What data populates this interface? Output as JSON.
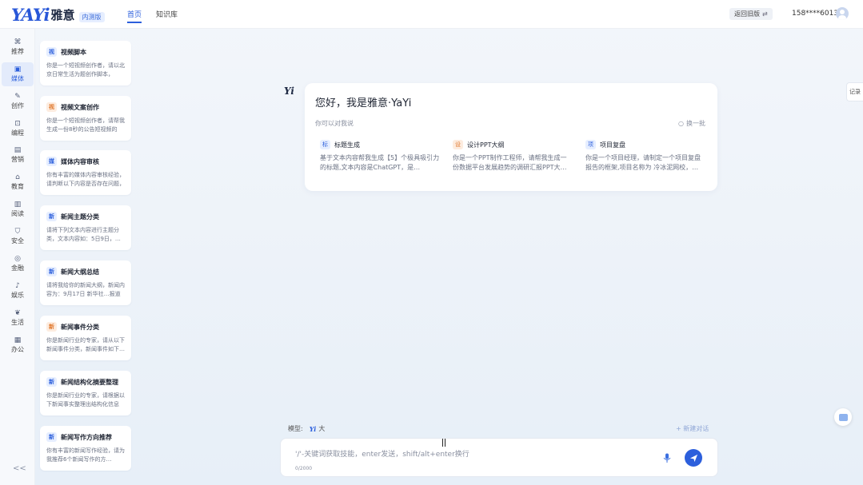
{
  "header": {
    "logo_text": "YAYi",
    "logo_cn": "雅意",
    "badge": "内测版",
    "tabs": [
      {
        "label": "首页",
        "active": true
      },
      {
        "label": "知识库",
        "active": false
      }
    ],
    "back_old": "返回旧版",
    "user_phone": "158****6013"
  },
  "rail": {
    "items": [
      {
        "label": "推荐",
        "icon": "grid-icon",
        "active": false
      },
      {
        "label": "媒体",
        "icon": "media-icon",
        "active": true
      },
      {
        "label": "创作",
        "icon": "edit-icon",
        "active": false
      },
      {
        "label": "编程",
        "icon": "code-icon",
        "active": false
      },
      {
        "label": "营销",
        "icon": "marketing-icon",
        "active": false
      },
      {
        "label": "教育",
        "icon": "education-icon",
        "active": false
      },
      {
        "label": "阅读",
        "icon": "book-icon",
        "active": false
      },
      {
        "label": "安全",
        "icon": "shield-icon",
        "active": false
      },
      {
        "label": "金融",
        "icon": "finance-icon",
        "active": false
      },
      {
        "label": "娱乐",
        "icon": "music-icon",
        "active": false
      },
      {
        "label": "生活",
        "icon": "leaf-icon",
        "active": false
      },
      {
        "label": "办公",
        "icon": "office-icon",
        "active": false
      }
    ],
    "collapse": "<<"
  },
  "cards": [
    {
      "tag": "视",
      "title": "视频脚本",
      "desc": "你是一个短视频创作者，请以北京日常生活为题创作脚本，",
      "tag_color": "#2c5fdc",
      "tag_bg": "#e6eeff"
    },
    {
      "tag": "视",
      "title": "视频文案创作",
      "desc": "你是一个短视频创作者，请帮我生成一份8秒的公告短视频的",
      "tag_color": "#e0772b",
      "tag_bg": "#fdecdf"
    },
    {
      "tag": "媒",
      "title": "媒体内容审核",
      "desc": "你有丰富的媒体内容审核经验，请判断以下内容是否存在问题，",
      "tag_color": "#2c5fdc",
      "tag_bg": "#e6eeff"
    },
    {
      "tag": "新",
      "title": "新闻主题分类",
      "desc": "请将下列文本内容进行主题分类，文本内容如：5日9日，…",
      "tag_color": "#2c5fdc",
      "tag_bg": "#e6eeff"
    },
    {
      "tag": "新",
      "title": "新闻大纲总结",
      "desc": "请将我给你的新闻大纲，新闻内容为：9月17日 新华社…报道",
      "tag_color": "#2c5fdc",
      "tag_bg": "#e6eeff"
    },
    {
      "tag": "新",
      "title": "新闻事件分类",
      "desc": "你是新闻行业的专家，请从以下新闻事件分类，新闻事件如下…",
      "tag_color": "#e0772b",
      "tag_bg": "#fdecdf"
    },
    {
      "tag": "新",
      "title": "新闻结构化摘要整理",
      "desc": "你是新闻行业的专家，请根据以下新闻事实整理出结构化信息",
      "tag_color": "#2c5fdc",
      "tag_bg": "#e6eeff"
    },
    {
      "tag": "新",
      "title": "新闻写作方向推荐",
      "desc": "你有丰富的新闻写作经验，请为我推荐6个新闻写作的方…",
      "tag_color": "#2c5fdc",
      "tag_bg": "#e6eeff"
    }
  ],
  "chat": {
    "bot_mark": "Yi",
    "greeting": "您好，我是雅意·YaYi",
    "hint": "你可以对我说",
    "refresh": "换一批",
    "suggestions": [
      {
        "icon": "标",
        "title": "标题生成",
        "desc": "基于文本内容帮我生成【5】个极具吸引力的标题,文本内容是ChatGPT，是…",
        "icon_color": "#2c5fdc",
        "icon_bg": "#e6eeff"
      },
      {
        "icon": "设",
        "title": "设计PPT大纲",
        "desc": "你是一个PPT制作工程师，请帮我生成一份数据平台发展趋势的调研汇报PPT大…",
        "icon_color": "#e0772b",
        "icon_bg": "#fdecdf"
      },
      {
        "icon": "项",
        "title": "项目复盘",
        "desc": "你是一个项目经理，请制定一个项目复盘报告的框架,项目名称为 冷冰泥网校，…",
        "icon_color": "#2c5fdc",
        "icon_bg": "#e6eeff"
      }
    ]
  },
  "side": {
    "history": "记录"
  },
  "composer": {
    "model_label": "模型:",
    "model_mark": "Yi",
    "model_name": "大",
    "new_chat": "+ 新建对话",
    "placeholder": "'/'-关键词获取技能，enter发送，shift/alt+enter换行",
    "counter": "0/2000"
  },
  "colors": {
    "accent": "#2c5fdc",
    "orange": "#e0772b"
  }
}
